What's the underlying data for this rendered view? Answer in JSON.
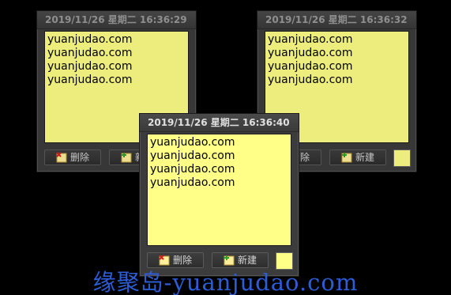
{
  "notes": [
    {
      "title": "2019/11/26 星期二 16:36:29",
      "lines": [
        "yuanjudao.com",
        "yuanjudao.com",
        "yuanjudao.com",
        "yuanjudao.com"
      ],
      "delete_label": "删除",
      "new_label": "新建"
    },
    {
      "title": "2019/11/26 星期二 16:36:32",
      "lines": [
        "yuanjudao.com",
        "yuanjudao.com",
        "yuanjudao.com",
        "yuanjudao.com"
      ],
      "delete_label": "删除",
      "new_label": "新建"
    },
    {
      "title": "2019/11/26 星期二 16:36:40",
      "lines": [
        "yuanjudao.com",
        "yuanjudao.com",
        "yuanjudao.com",
        "yuanjudao.com"
      ],
      "delete_label": "删除",
      "new_label": "新建"
    }
  ],
  "icons": {
    "delete": "delete-note-icon",
    "new": "new-note-icon"
  },
  "colors": {
    "note_yellow": "#ffff88",
    "window_frame": "#3c3c3c",
    "watermark": "#2c5cd6"
  },
  "watermark": "缘聚岛-yuanjudao.com"
}
